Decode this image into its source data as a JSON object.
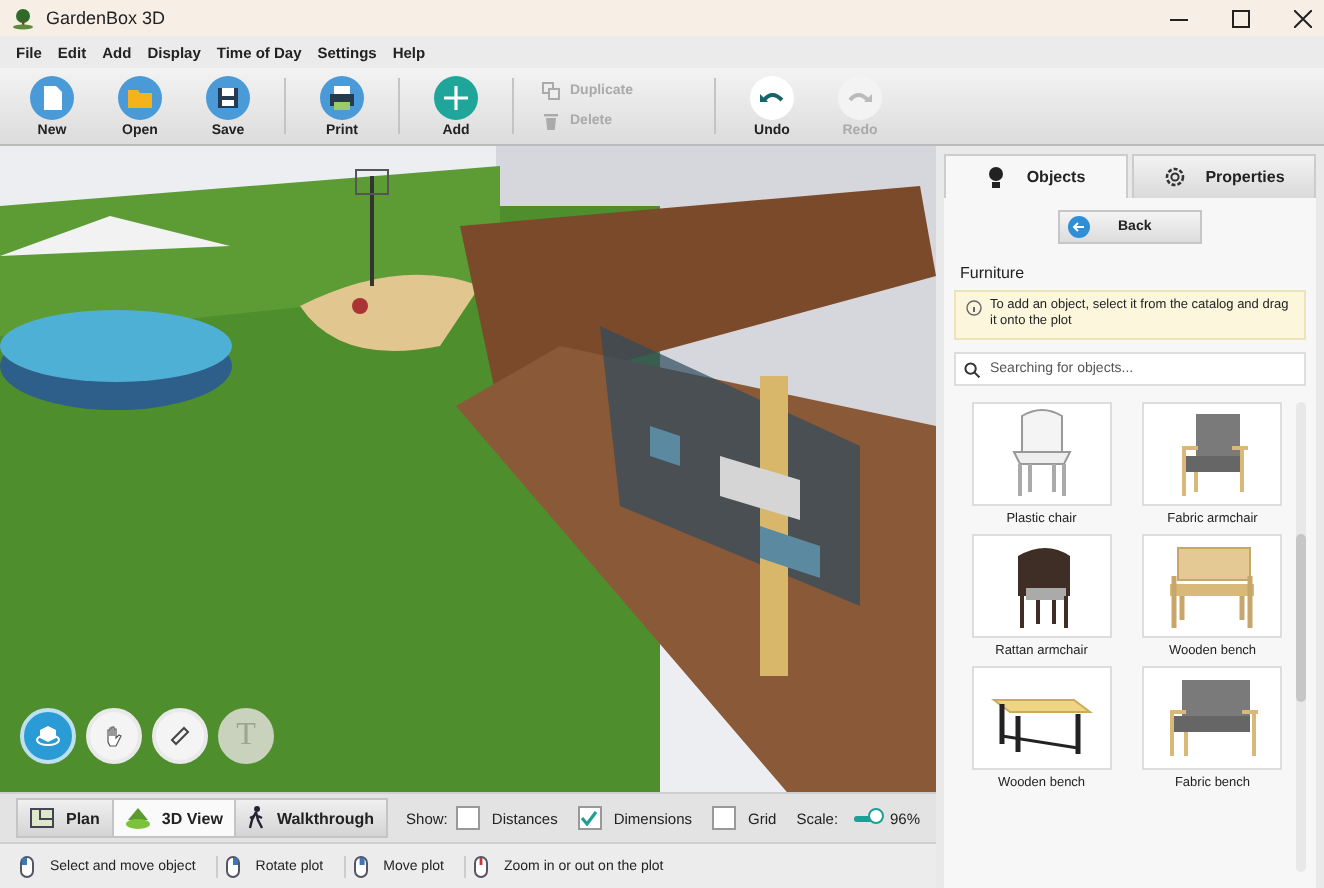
{
  "window": {
    "title": "GardenBox 3D"
  },
  "menu": [
    "File",
    "Edit",
    "Add",
    "Display",
    "Time of Day",
    "Settings",
    "Help"
  ],
  "toolbar": [
    {
      "kind": "new",
      "label": "New",
      "disabled": false
    },
    {
      "kind": "open",
      "label": "Open",
      "disabled": false
    },
    {
      "kind": "save",
      "label": "Save",
      "disabled": false
    },
    {
      "kind": "sep"
    },
    {
      "kind": "print",
      "label": "Print",
      "disabled": false
    },
    {
      "kind": "sep"
    },
    {
      "kind": "add",
      "label": "Add",
      "disabled": false
    },
    {
      "kind": "sep"
    },
    {
      "kind": "pair",
      "items": [
        {
          "kind": "duplicate",
          "label": "Duplicate",
          "disabled": true
        },
        {
          "kind": "delete",
          "label": "Delete",
          "disabled": true
        }
      ]
    },
    {
      "kind": "sep"
    },
    {
      "kind": "undo",
      "label": "Undo",
      "disabled": false
    },
    {
      "kind": "redo",
      "label": "Redo",
      "disabled": true
    }
  ],
  "view_tools": [
    {
      "kind": "orbit",
      "selected": true,
      "disabled": false
    },
    {
      "kind": "hand",
      "selected": false,
      "disabled": false
    },
    {
      "kind": "ruler",
      "selected": false,
      "disabled": false
    },
    {
      "kind": "text",
      "label": "T",
      "selected": false,
      "disabled": true
    }
  ],
  "view_modes": [
    {
      "kind": "plan",
      "label": "Plan",
      "selected": false
    },
    {
      "kind": "terrain",
      "label": "3D View",
      "selected": true
    },
    {
      "kind": "walk",
      "label": "Walkthrough",
      "selected": false
    }
  ],
  "show": {
    "label": "Show:",
    "options": [
      {
        "label": "Distances",
        "checked": false
      },
      {
        "label": "Dimensions",
        "checked": true
      },
      {
        "label": "Grid",
        "checked": false
      }
    ]
  },
  "scale": {
    "label": "Scale:",
    "level": 0.9,
    "reading": "96%"
  },
  "status_bar": [
    {
      "kind": "left",
      "text": "Select and move object"
    },
    {
      "kind": "right",
      "text": "Rotate plot"
    },
    {
      "kind": "wheel",
      "text": "Move plot"
    },
    {
      "kind": "zoom",
      "text": "Zoom in or out on the plot"
    }
  ],
  "panel": {
    "tabs": [
      {
        "kind": "objects",
        "label": "Objects",
        "selected": true
      },
      {
        "kind": "gear",
        "label": "Properties",
        "selected": false
      }
    ],
    "back": "Back",
    "heading": "Furniture",
    "info": "To add an object, select it from the catalog and drag it onto the plot",
    "search": {
      "placeholder": "Searching for objects..."
    },
    "items": [
      {
        "kind": "plastic",
        "name": "Plastic chair"
      },
      {
        "kind": "armchair",
        "name": "Fabric armchair"
      },
      {
        "kind": "rattan",
        "name": "Rattan armchair"
      },
      {
        "kind": "bench",
        "name": "Wooden bench"
      },
      {
        "kind": "plain-bench",
        "name": "Wooden bench"
      },
      {
        "kind": "sofa",
        "name": "Fabric bench"
      }
    ]
  }
}
